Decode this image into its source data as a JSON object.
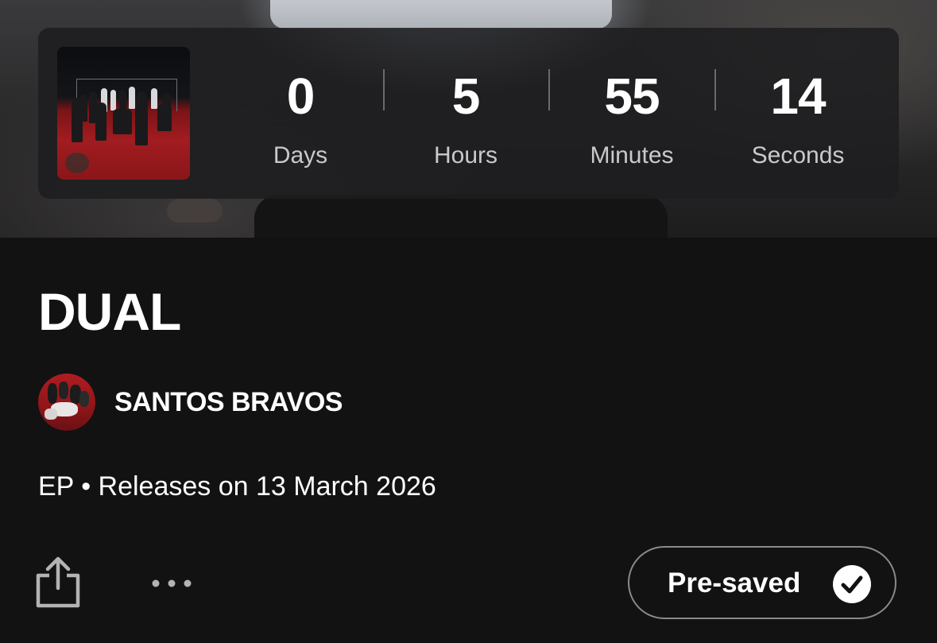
{
  "countdown": {
    "timers": [
      {
        "value": "0",
        "unit": "Days"
      },
      {
        "value": "5",
        "unit": "Hours"
      },
      {
        "value": "55",
        "unit": "Minutes"
      },
      {
        "value": "14",
        "unit": "Seconds"
      }
    ]
  },
  "release": {
    "title": "DUAL",
    "artist": "SANTOS BRAVOS",
    "meta": "EP • Releases on 13 March 2026"
  },
  "actions": {
    "presave_label": "Pre-saved",
    "share_icon": "share-icon",
    "more_icon": "more-options-icon",
    "check_icon": "checkmark-circle-icon"
  },
  "colors": {
    "background": "#121212",
    "card": "#1e1e20",
    "unit_text": "#c9c9cb",
    "button_border": "#8a8a8c"
  }
}
